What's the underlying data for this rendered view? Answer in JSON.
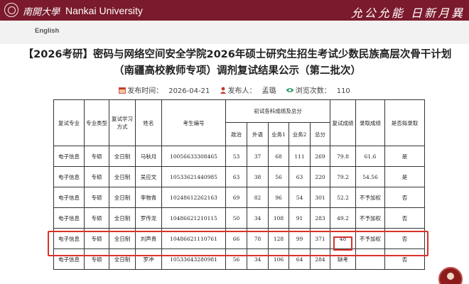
{
  "header": {
    "logo_cn": "南開大學",
    "logo_en": "Nankai University",
    "motto": "允公允能 日新月異"
  },
  "lang_bar": {
    "english": "English"
  },
  "article": {
    "title": "【2026考研】密码与网络空间安全学院2026年硕士研究生招生考试少数民族高层次骨干计划（南疆高校教师专项）调剂复试结果公示（第二批次）",
    "meta": {
      "publish_label": "发布时间：",
      "publish_date": "2026-04-21",
      "author_label": "发布人：",
      "author": "孟璐",
      "views_label": "浏览次数：",
      "views": "110"
    }
  },
  "table": {
    "headers": {
      "major": "复试专业",
      "type": "专业类型",
      "mode": "复试学习方式",
      "name": "姓名",
      "exam_id": "考生编号",
      "prelim_group": "初试各科成绩及总分",
      "politics": "政治",
      "foreign": "外语",
      "subject1": "业务1",
      "subject2": "业务2",
      "total": "总分",
      "interview": "复试成绩",
      "admission_score": "录取成绩",
      "admit": "是否拟录取"
    },
    "rows": [
      {
        "major": "电子信息",
        "type": "专硕",
        "mode": "全日制",
        "name": "马秋月",
        "exam_id": "10056633308465",
        "politics": "53",
        "foreign": "37",
        "subject1": "68",
        "subject2": "111",
        "total": "269",
        "interview": "79.8",
        "admission_score": "61.6",
        "admit": "是"
      },
      {
        "major": "电子信息",
        "type": "专硕",
        "mode": "全日制",
        "name": "吴应文",
        "exam_id": "10533621440985",
        "politics": "63",
        "foreign": "38",
        "subject1": "56",
        "subject2": "63",
        "total": "220",
        "interview": "79.2",
        "admission_score": "54.56",
        "admit": "是"
      },
      {
        "major": "电子信息",
        "type": "专硕",
        "mode": "全日制",
        "name": "李物青",
        "exam_id": "10248612262163",
        "politics": "69",
        "foreign": "82",
        "subject1": "96",
        "subject2": "54",
        "total": "301",
        "interview": "52.2",
        "admission_score": "不予加权",
        "admit": "否"
      },
      {
        "major": "电子信息",
        "type": "专硕",
        "mode": "全日制",
        "name": "罗传龙",
        "exam_id": "10486621210115",
        "politics": "50",
        "foreign": "34",
        "subject1": "108",
        "subject2": "91",
        "total": "283",
        "interview": "49.2",
        "admission_score": "不予加权",
        "admit": "否"
      },
      {
        "major": "电子信息",
        "type": "专硕",
        "mode": "全日制",
        "name": "刘声贵",
        "exam_id": "10486621110761",
        "politics": "66",
        "foreign": "78",
        "subject1": "128",
        "subject2": "99",
        "total": "371",
        "interview": "48",
        "admission_score": "不予加权",
        "admit": "否"
      },
      {
        "major": "电子信息",
        "type": "专硕",
        "mode": "全日制",
        "name": "罗冲",
        "exam_id": "10533643280981",
        "politics": "56",
        "foreign": "34",
        "subject1": "106",
        "subject2": "64",
        "total": "284",
        "interview": "缺考",
        "admission_score": "",
        "admit": "否"
      }
    ]
  },
  "colors": {
    "banner": "#7a1a2c",
    "highlight": "#d9322b",
    "views_icon": "#2e9c6a",
    "meta_icon": "#c0392b"
  }
}
